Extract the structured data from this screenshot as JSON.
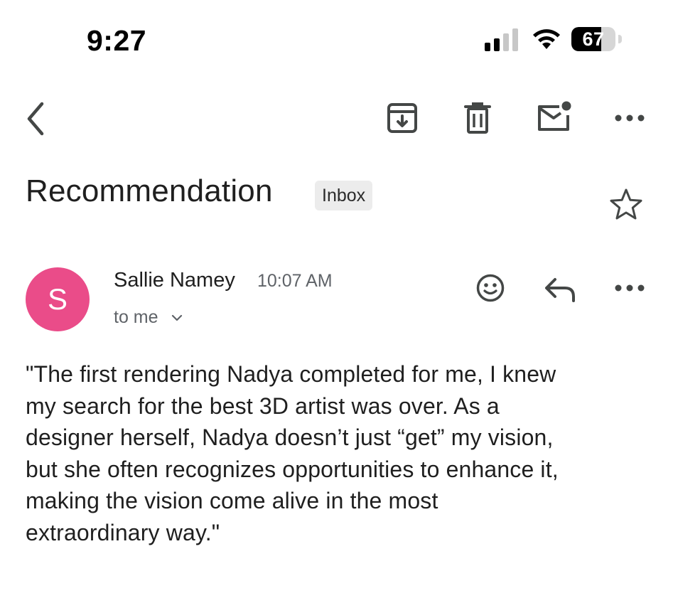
{
  "status_bar": {
    "time": "9:27",
    "battery_level": "67",
    "battery_percent": 67
  },
  "toolbar": {
    "icons": [
      "back-arrow-icon",
      "archive-icon",
      "trash-icon",
      "mark-unread-icon",
      "more-options-icon"
    ]
  },
  "email": {
    "subject": "Recommendation",
    "label": "Inbox",
    "sender": {
      "initial": "S",
      "name": "Sallie Namey",
      "time": "10:07 AM",
      "recipient": "to me",
      "avatar_color": "#ea4c89"
    },
    "body_lines": [
      "\"The first rendering Nadya completed for me, I knew",
      "my search for the best 3D artist was over.  As a",
      "designer herself, Nadya doesn’t just “get” my vision,",
      "but she often recognizes opportunities to enhance it,",
      "making the vision come alive in the most",
      "extraordinary way.\""
    ]
  },
  "colors": {
    "text_primary": "#1f1f1f",
    "text_secondary": "#5f6368",
    "icon": "#444746",
    "chip_bg": "#ececec"
  }
}
